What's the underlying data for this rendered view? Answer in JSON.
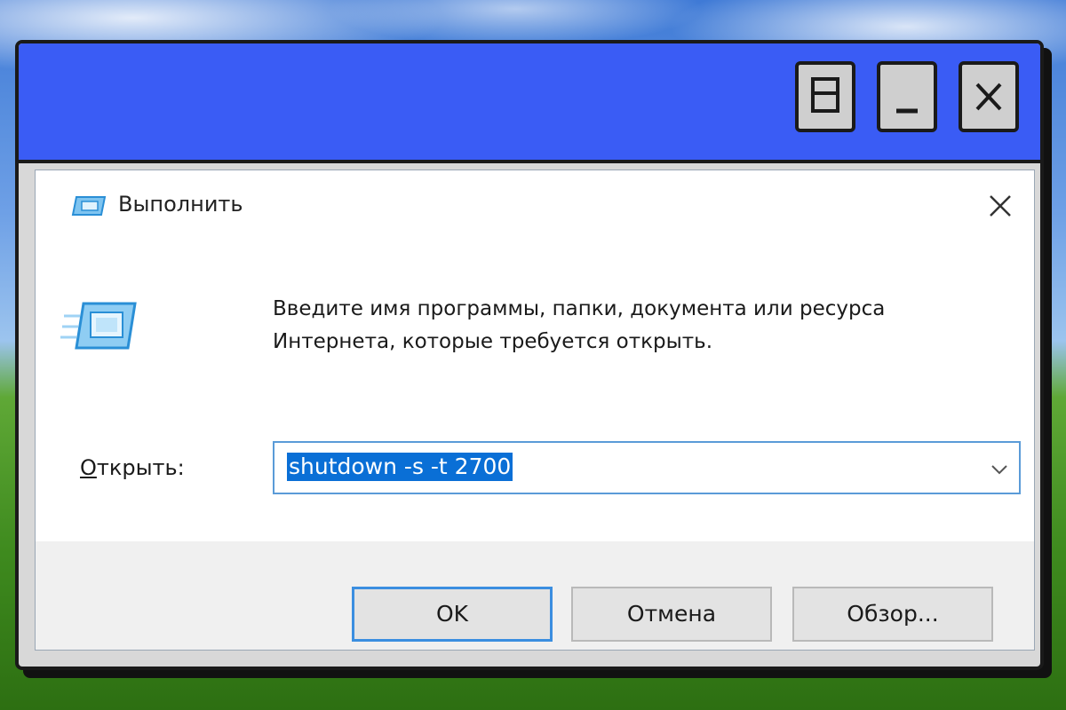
{
  "dialog": {
    "title": "Выполнить",
    "description": "Введите имя программы, папки, документа или ресурса Интернета, которые требуется открыть.",
    "open_label_accel": "О",
    "open_label_rest": "ткрыть:",
    "command_value": "shutdown -s -t 2700",
    "buttons": {
      "ok": "OK",
      "cancel": "Отмена",
      "browse": "Обзор..."
    }
  },
  "icons": {
    "window_restore": "restore-icon",
    "window_minimize": "minimize-icon",
    "window_close": "close-icon",
    "dialog_close": "close-icon",
    "run_app": "run-app-icon",
    "combo_dropdown": "chevron-down-icon"
  },
  "colors": {
    "retro_titlebar": "#3a5cf5",
    "selection": "#0a6fd6",
    "focus_border": "#3b8ee0"
  }
}
